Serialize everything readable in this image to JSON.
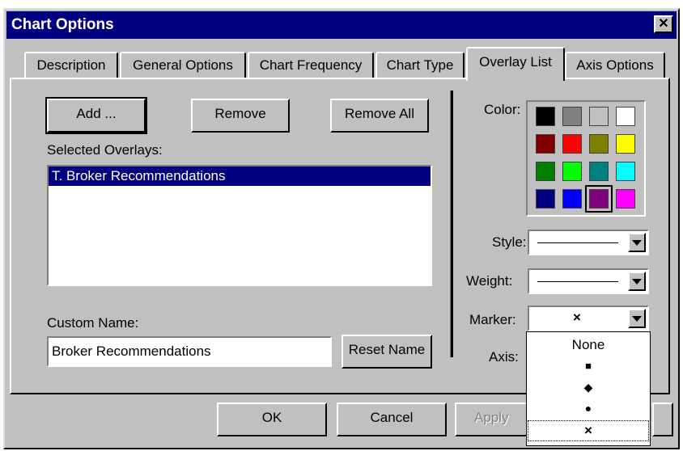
{
  "window": {
    "title": "Chart Options",
    "close_glyph": "✕"
  },
  "tabs": [
    {
      "label": "Description"
    },
    {
      "label": "General Options"
    },
    {
      "label": "Chart Frequency"
    },
    {
      "label": "Chart Type"
    },
    {
      "label": "Overlay List",
      "active": true
    },
    {
      "label": "Axis Options"
    }
  ],
  "overlay": {
    "add_label": "Add ...",
    "remove_label": "Remove",
    "remove_all_label": "Remove All",
    "selected_overlays_label": "Selected Overlays:",
    "selected_overlays": [
      "T. Broker Recommendations"
    ],
    "custom_name_label": "Custom Name:",
    "custom_name_value": "Broker Recommendations",
    "reset_name_label": "Reset Name"
  },
  "properties": {
    "color_label": "Color:",
    "colors": [
      "#000000",
      "#808080",
      "#c0c0c0",
      "#ffffff",
      "#800000",
      "#ff0000",
      "#808000",
      "#ffff00",
      "#008000",
      "#00ff00",
      "#008080",
      "#00ffff",
      "#000080",
      "#0000ff",
      "#800080",
      "#ff00ff"
    ],
    "selected_color": "#800080",
    "style_label": "Style:",
    "weight_label": "Weight:",
    "marker_label": "Marker:",
    "marker_value": "×",
    "axis_label": "Axis:",
    "marker_options": [
      "None",
      "■",
      "◆",
      "●",
      "×"
    ],
    "marker_focused_index": 4
  },
  "footer": {
    "ok_label": "OK",
    "cancel_label": "Cancel",
    "apply_label": "Apply"
  }
}
